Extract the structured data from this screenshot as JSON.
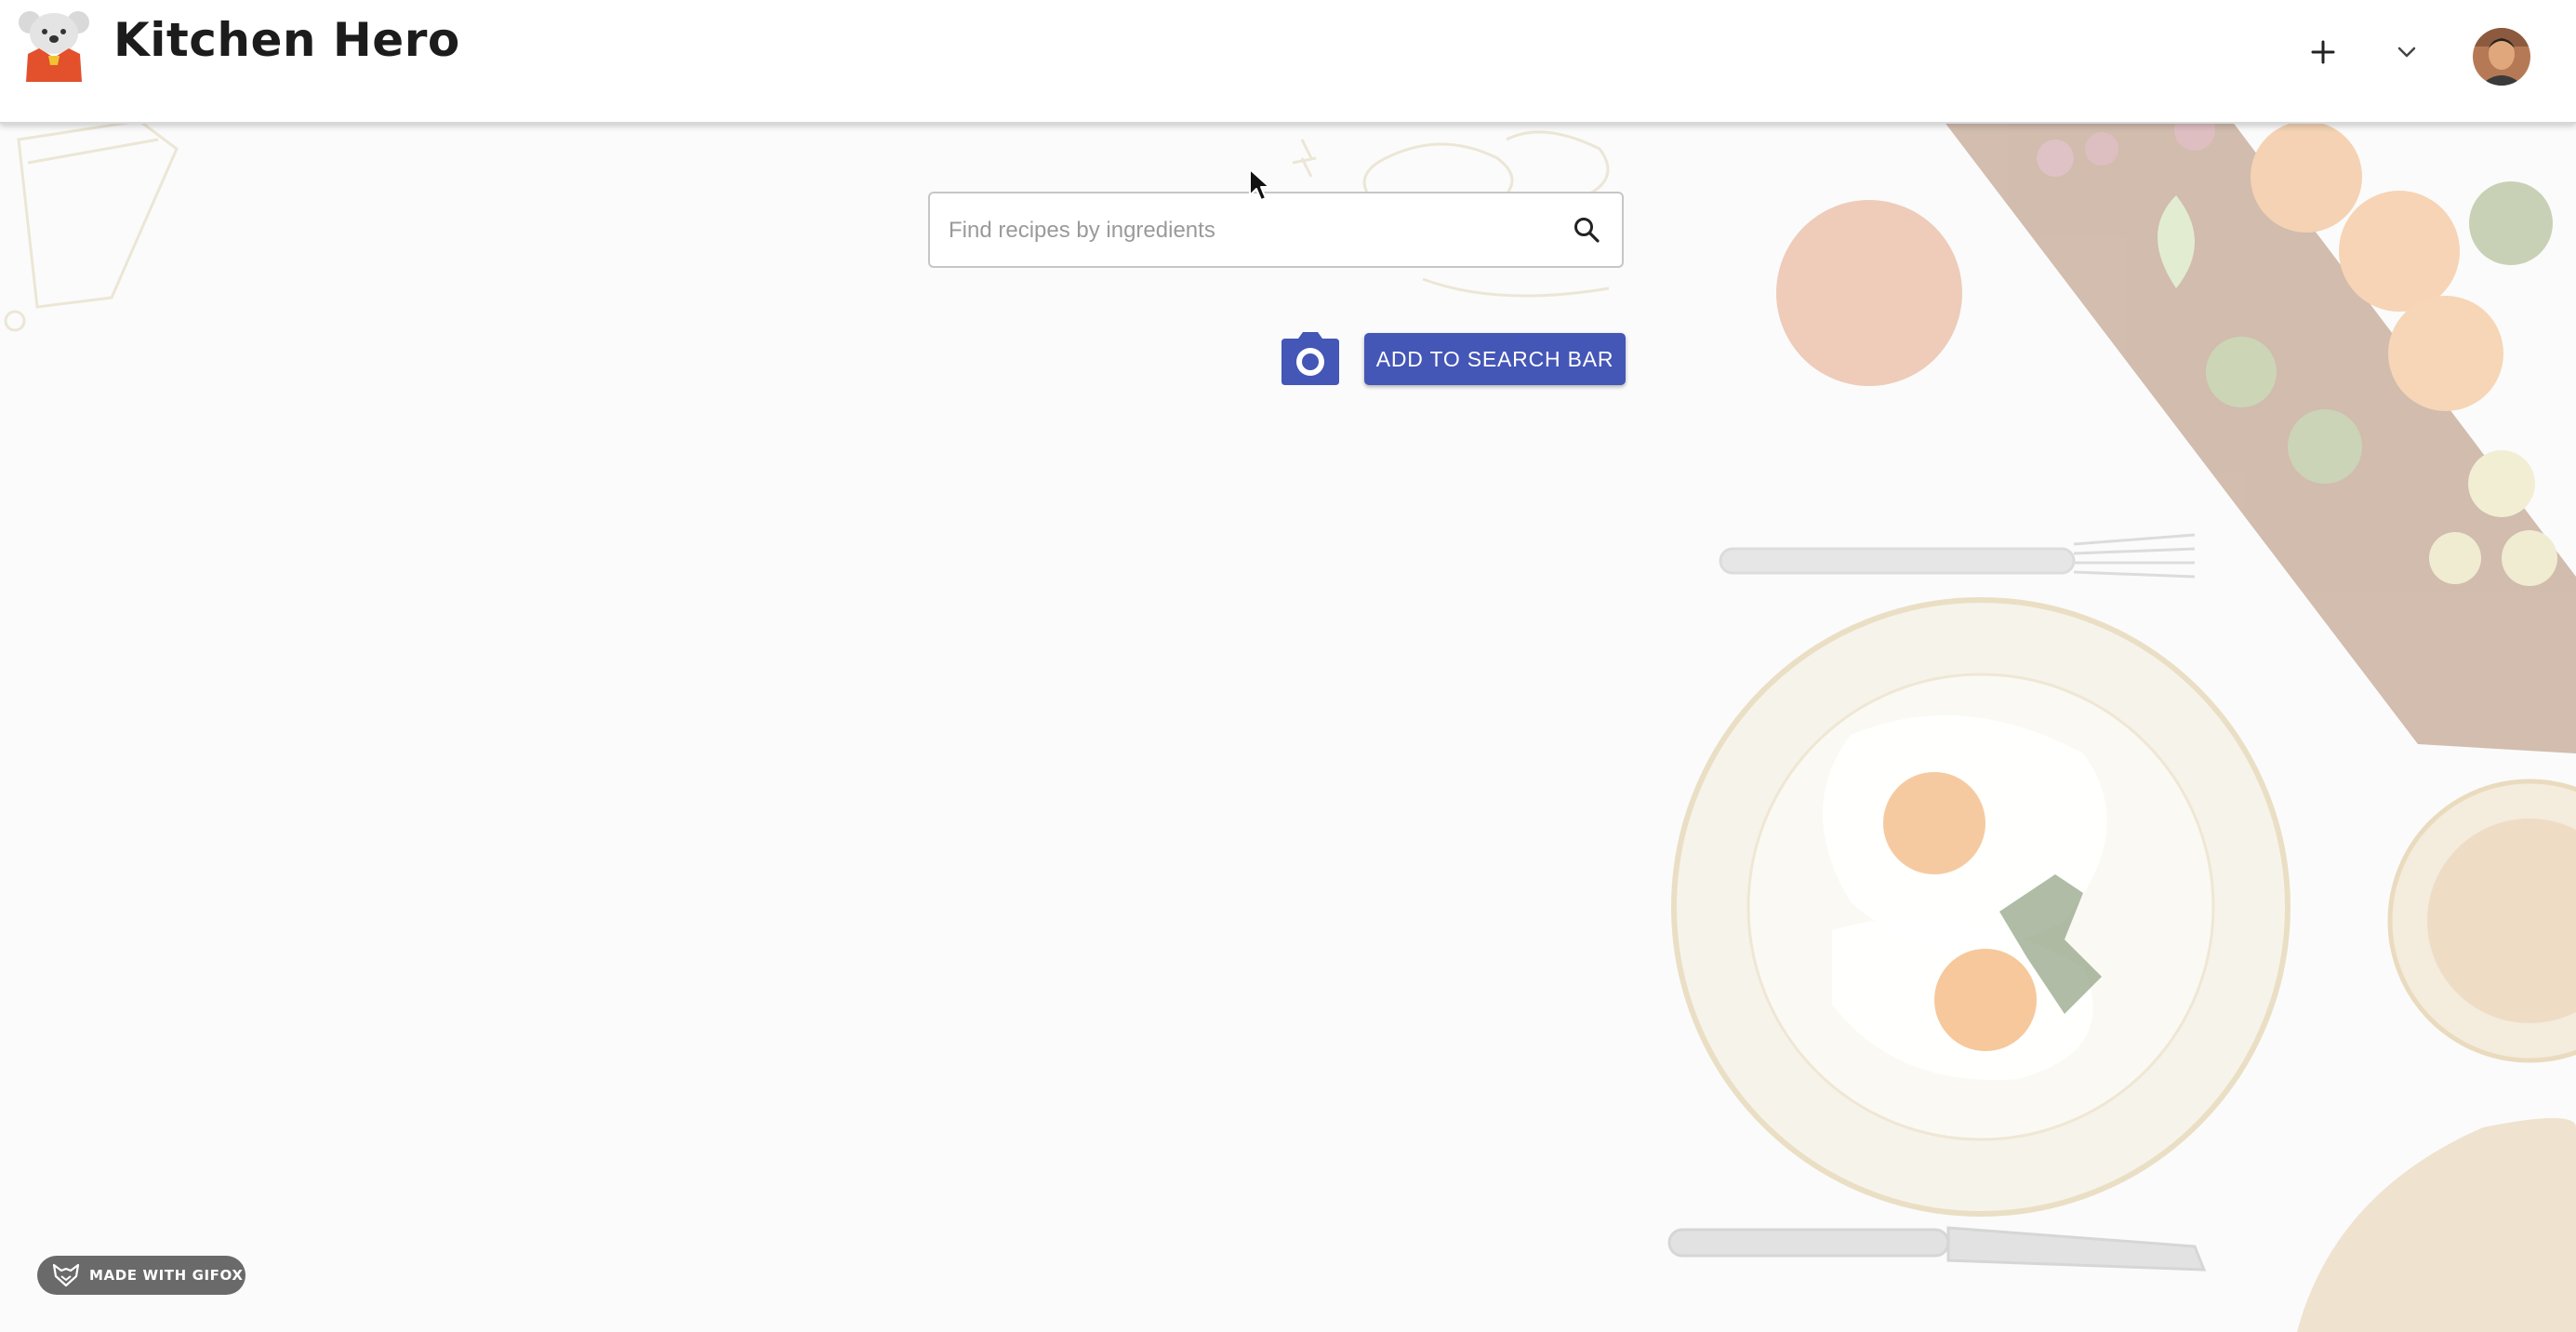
{
  "app": {
    "brand": "Kitchen Hero"
  },
  "header": {
    "add_icon": "plus-icon",
    "menu_icon": "chevron-down-icon",
    "avatar_icon": "user-avatar"
  },
  "search": {
    "placeholder": "Find recipes by ingredients",
    "value": "",
    "icon": "search-icon"
  },
  "actions": {
    "camera_icon": "camera-icon",
    "add_to_search_label": "ADD TO SEARCH BAR"
  },
  "badge": {
    "label": "MADE WITH GIFOX",
    "icon": "gifox-logo-icon"
  },
  "colors": {
    "primary": "#4456b6",
    "header_bg": "#ffffff",
    "page_bg": "#fbfbfb",
    "badge_bg": "#6a6a6a"
  }
}
